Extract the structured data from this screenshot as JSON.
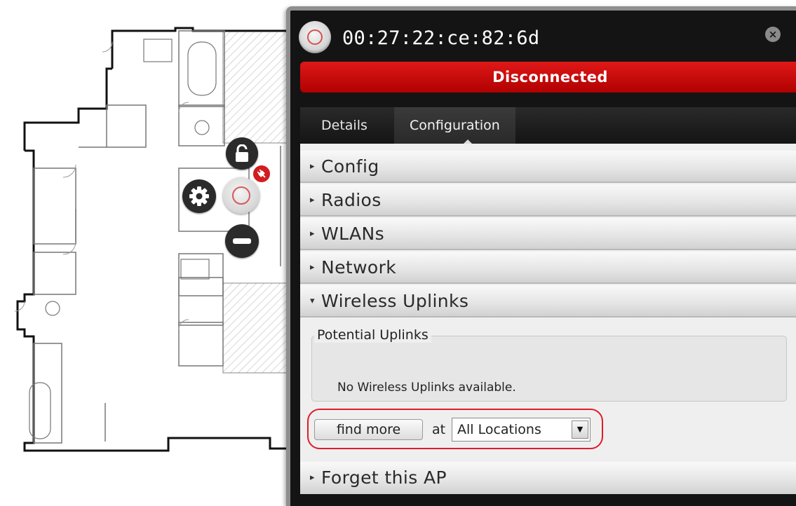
{
  "panel": {
    "title": "00:27:22:ce:82:6d",
    "status": "Disconnected",
    "status_color": "#c00000",
    "close_icon": "×"
  },
  "tabs": [
    {
      "label": "Details",
      "active": false
    },
    {
      "label": "Configuration",
      "active": true
    }
  ],
  "sections": {
    "config": "Config",
    "radios": "Radios",
    "wlans": "WLANs",
    "network": "Network",
    "wireless_uplinks": "Wireless Uplinks",
    "forget": "Forget this AP"
  },
  "uplinks": {
    "legend": "Potential Uplinks",
    "empty_text": "No Wireless Uplinks available.",
    "find_more_label": "find more",
    "at_label": "at",
    "location_selected": "All Locations"
  },
  "icons": {
    "collapsed_arrow": "▸",
    "expanded_arrow": "▾",
    "select_caret": "▼"
  },
  "colors": {
    "highlight_ring": "#e21b2a",
    "panel_bg": "#141414",
    "ap_ring": "#d65a5a"
  }
}
